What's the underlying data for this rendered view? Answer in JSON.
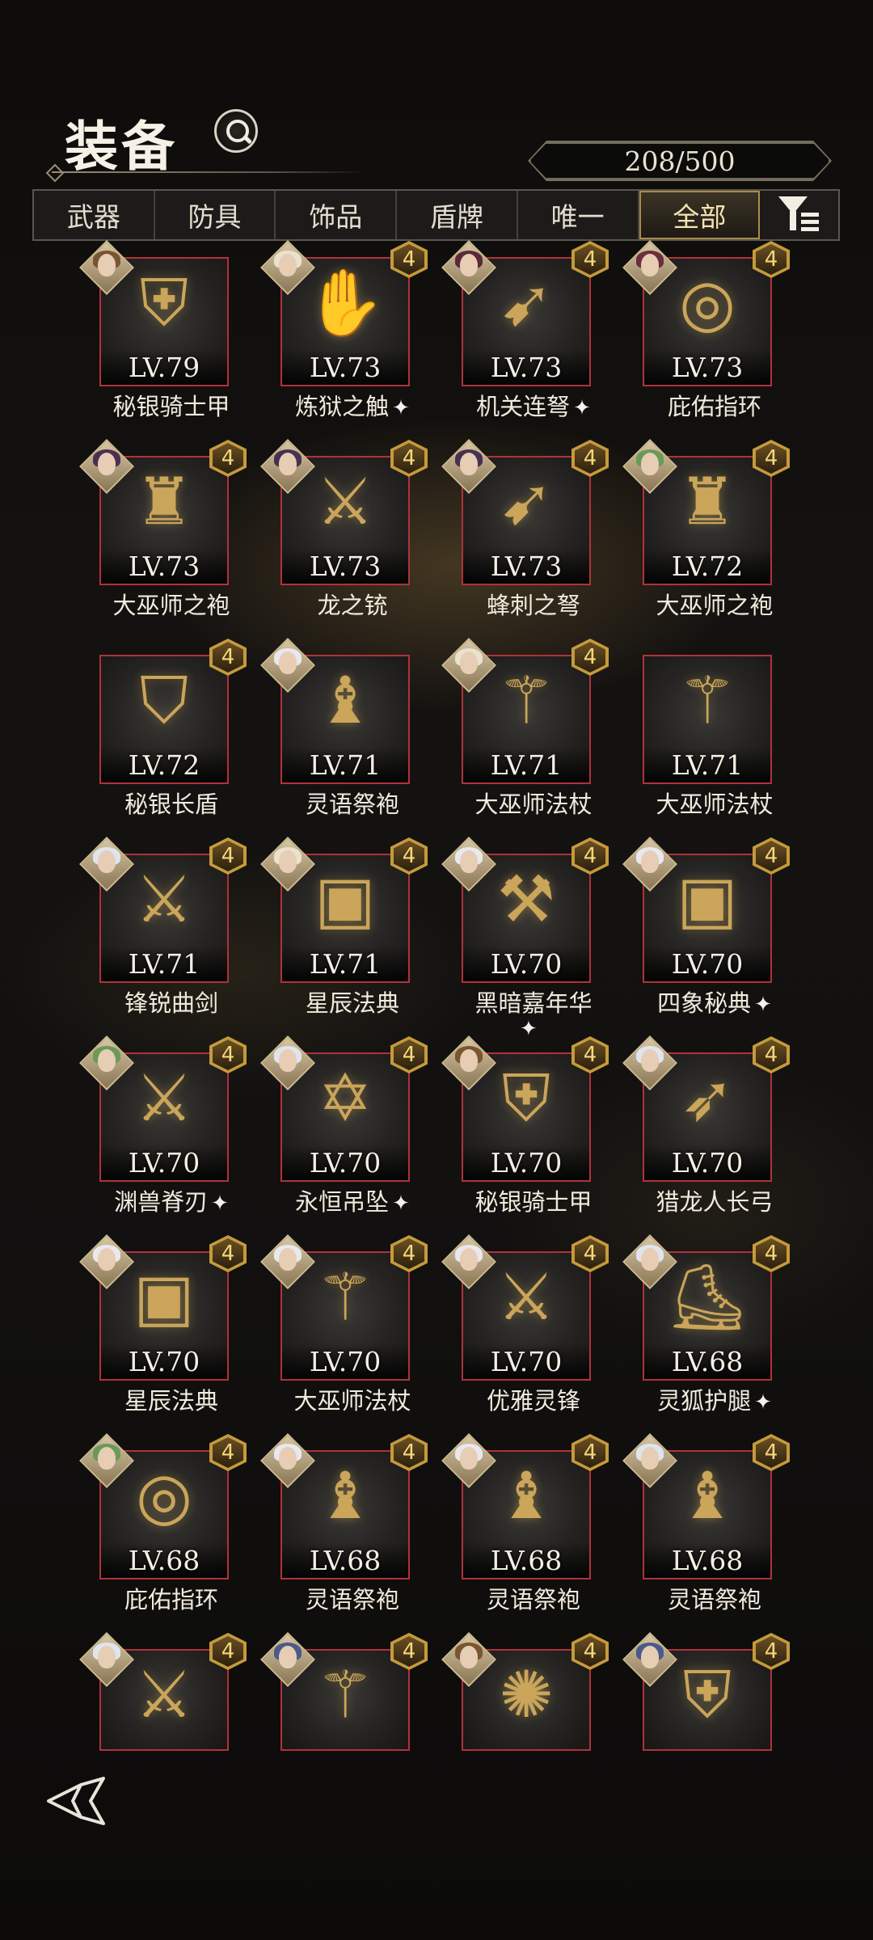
{
  "header": {
    "title": "装备",
    "counter": "208/500"
  },
  "tabs": [
    {
      "label": "武器",
      "active": false
    },
    {
      "label": "防具",
      "active": false
    },
    {
      "label": "饰品",
      "active": false
    },
    {
      "label": "盾牌",
      "active": false
    },
    {
      "label": "唯一",
      "active": false
    },
    {
      "label": "全部",
      "active": true
    }
  ],
  "items": [
    {
      "level": "LV.79",
      "name": "秘银骑士甲",
      "rank": "",
      "spark": false,
      "icon": "chest-armor-icon",
      "hair": "#7a5532"
    },
    {
      "level": "LV.73",
      "name": "炼狱之触",
      "rank": "4",
      "spark": true,
      "icon": "dark-gauntlet-icon",
      "hair": "#e8e2cf"
    },
    {
      "level": "LV.73",
      "name": "机关连弩",
      "rank": "4",
      "spark": true,
      "icon": "crossbow-icon",
      "hair": "#5a2a3a"
    },
    {
      "level": "LV.73",
      "name": "庇佑指环",
      "rank": "4",
      "spark": false,
      "icon": "ring-icon",
      "hair": "#6a2e3c"
    },
    {
      "level": "LV.73",
      "name": "大巫师之袍",
      "rank": "4",
      "spark": false,
      "icon": "robe-icon",
      "hair": "#4a3050"
    },
    {
      "level": "LV.73",
      "name": "龙之铳",
      "rank": "4",
      "spark": false,
      "icon": "gun-icon",
      "hair": "#4a3050"
    },
    {
      "level": "LV.73",
      "name": "蜂刺之弩",
      "rank": "4",
      "spark": false,
      "icon": "crossbow-icon",
      "hair": "#4a3050"
    },
    {
      "level": "LV.72",
      "name": "大巫师之袍",
      "rank": "4",
      "spark": false,
      "icon": "robe-icon",
      "hair": "#6a9a58"
    },
    {
      "level": "LV.72",
      "name": "秘银长盾",
      "rank": "4",
      "spark": false,
      "icon": "shield-icon",
      "hair": ""
    },
    {
      "level": "LV.71",
      "name": "灵语祭袍",
      "rank": "",
      "spark": false,
      "icon": "ritual-robe-icon",
      "hair": "#e8e8ee"
    },
    {
      "level": "LV.71",
      "name": "大巫师法杖",
      "rank": "4",
      "spark": false,
      "icon": "staff-icon",
      "hair": "#e8e2cf"
    },
    {
      "level": "LV.71",
      "name": "大巫师法杖",
      "rank": "",
      "spark": false,
      "icon": "staff-icon",
      "hair": ""
    },
    {
      "level": "LV.71",
      "name": "锋锐曲剑",
      "rank": "4",
      "spark": false,
      "icon": "sword-icon",
      "hair": "#dfe4ee"
    },
    {
      "level": "LV.71",
      "name": "星辰法典",
      "rank": "4",
      "spark": false,
      "icon": "tome-icon",
      "hair": "#e8e2cf"
    },
    {
      "level": "LV.70",
      "name": "黑暗嘉年华",
      "rank": "4",
      "spark": true,
      "icon": "hammer-icon",
      "hair": "#e8e8ee"
    },
    {
      "level": "LV.70",
      "name": "四象秘典",
      "rank": "4",
      "spark": true,
      "icon": "tome-icon",
      "hair": "#e8e8ee"
    },
    {
      "level": "LV.70",
      "name": "渊兽脊刃",
      "rank": "4",
      "spark": true,
      "icon": "blade-icon",
      "hair": "#6a9a58"
    },
    {
      "level": "LV.70",
      "name": "永恒吊坠",
      "rank": "4",
      "spark": true,
      "icon": "pendant-icon",
      "hair": "#dfe4ee"
    },
    {
      "level": "LV.70",
      "name": "秘银骑士甲",
      "rank": "4",
      "spark": false,
      "icon": "chest-armor-icon",
      "hair": "#7a5532"
    },
    {
      "level": "LV.70",
      "name": "猎龙人长弓",
      "rank": "4",
      "spark": false,
      "icon": "bow-icon",
      "hair": "#dfe4ee"
    },
    {
      "level": "LV.70",
      "name": "星辰法典",
      "rank": "4",
      "spark": false,
      "icon": "tome-icon",
      "hair": "#e8e8ee"
    },
    {
      "level": "LV.70",
      "name": "大巫师法杖",
      "rank": "4",
      "spark": false,
      "icon": "staff-icon",
      "hair": "#e8e8ee"
    },
    {
      "level": "LV.70",
      "name": "优雅灵锋",
      "rank": "4",
      "spark": false,
      "icon": "sword-icon",
      "hair": "#e8e8ee"
    },
    {
      "level": "LV.68",
      "name": "灵狐护腿",
      "rank": "4",
      "spark": true,
      "icon": "boots-icon",
      "hair": "#dfe4ee"
    },
    {
      "level": "LV.68",
      "name": "庇佑指环",
      "rank": "4",
      "spark": false,
      "icon": "ring-icon",
      "hair": "#6a9a58"
    },
    {
      "level": "LV.68",
      "name": "灵语祭袍",
      "rank": "4",
      "spark": false,
      "icon": "ritual-robe-icon",
      "hair": "#e8e8ee"
    },
    {
      "level": "LV.68",
      "name": "灵语祭袍",
      "rank": "4",
      "spark": false,
      "icon": "ritual-robe-icon",
      "hair": "#e8e8ee"
    },
    {
      "level": "LV.68",
      "name": "灵语祭袍",
      "rank": "4",
      "spark": false,
      "icon": "ritual-robe-icon",
      "hair": "#dfe4ee"
    },
    {
      "level": "",
      "name": "",
      "rank": "4",
      "spark": false,
      "icon": "sword-icon",
      "hair": "#dfe4ee"
    },
    {
      "level": "",
      "name": "",
      "rank": "4",
      "spark": false,
      "icon": "staff-icon",
      "hair": "#4a5a8a"
    },
    {
      "level": "",
      "name": "",
      "rank": "4",
      "spark": false,
      "icon": "web-shield-icon",
      "hair": "#7a5532"
    },
    {
      "level": "",
      "name": "",
      "rank": "4",
      "spark": false,
      "icon": "chest-armor-icon",
      "hair": "#4a5a8a"
    }
  ],
  "colors": {
    "tile_border": "#b0323a",
    "rank_gold": "#c59a3c",
    "active_tab": "#a98b4d"
  }
}
